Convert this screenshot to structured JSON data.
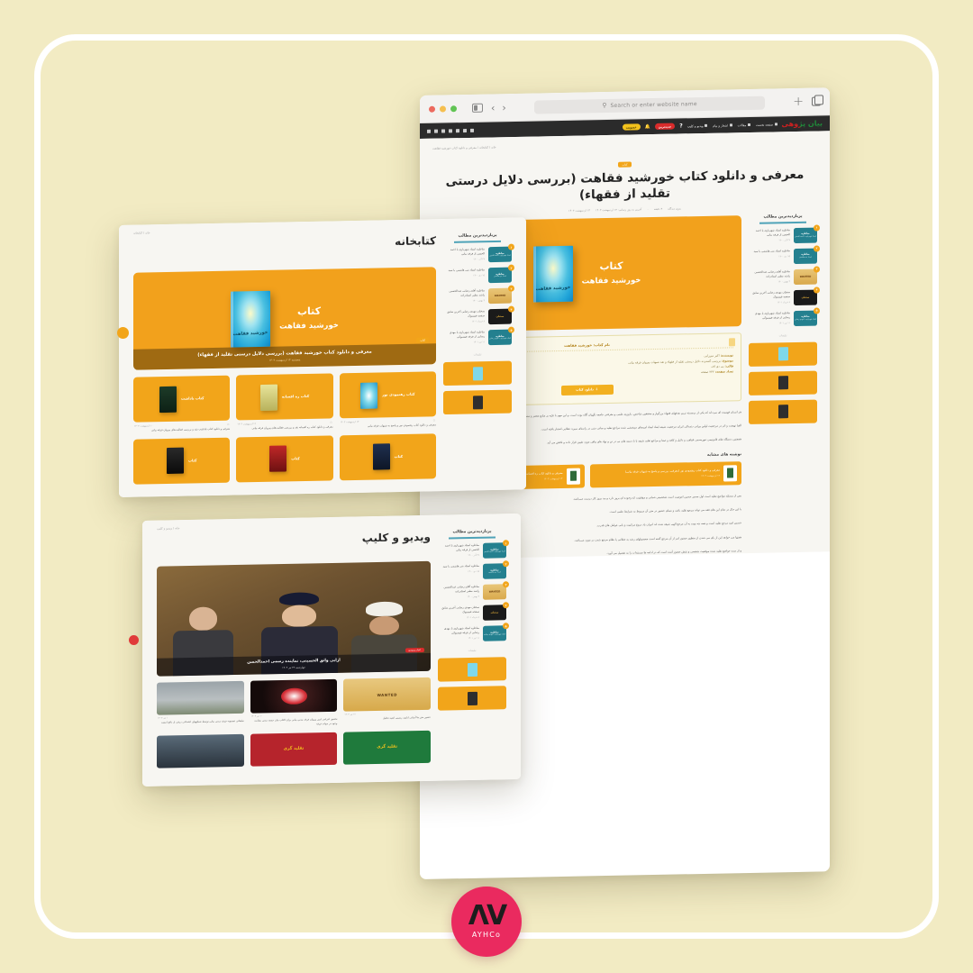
{
  "brand": {
    "logo_mark": "ΛV",
    "logo_name": "AYHCo",
    "accent_pink": "#ea2a5f",
    "accent_orange": "#f2a51a",
    "background": "#f2ebc3"
  },
  "browser": {
    "search_placeholder": "Search or enter website name",
    "traffic_lights": [
      "close",
      "minimize",
      "maximize"
    ],
    "back_label": "‹",
    "forward_label": "›",
    "new_tab_label": "+",
    "sidebar_icon": "sidebar-icon",
    "tabs_icon": "tabs-icon"
  },
  "site": {
    "logo_text": "بیان پژوهی",
    "nav": [
      {
        "label": "صفحه نخست"
      },
      {
        "label": "مقالات"
      },
      {
        "label": "اشعار و پیام"
      },
      {
        "label": "ویدیو و کلیپ"
      }
    ],
    "pill_red": "جدیدترین",
    "pill_yellow": "عضویت",
    "question_icon": "question-icon",
    "bell_icon": "bell-icon",
    "toolbar_icons": [
      "search-icon",
      "user-icon",
      "cart-icon",
      "grid-icon",
      "send-icon",
      "clock-icon",
      "list-icon"
    ]
  },
  "article": {
    "breadcrumb": "خانه / کتابخانه / معرفی و دانلود کتاب خورشید فقاهت",
    "badge": "کتاب",
    "title": "معرفی و دانلود کتاب خورشید فقاهت (بررسی دلایل درستی تقلید از فقهاء)",
    "meta": [
      "۱۴ اردیبهشت ۱۴۰۳",
      "آخرین به روز رسانی: ۱۳ اردیبهشت ۱۴۰۳",
      "۰",
      "۴ دقیقه",
      "بدون دیدگاه"
    ],
    "hero": {
      "line1": "کتاب",
      "line2": "خورشید فقاهت",
      "cover_title": "خورشید فقاهت"
    },
    "infobox": {
      "heading": "نام کتاب: خورشید فقاهت",
      "rows": [
        {
          "label": "نویسنده:",
          "value": "اکبر میرزایی"
        },
        {
          "label": "موضوع:",
          "value": "بررسی گسترده دلایل درستی تقلید از فقهاء و نقد شبهات پیروان فرقه بیانی"
        },
        {
          "label": "قالب:",
          "value": "پی دی اف"
        },
        {
          "label": "تعداد صفحه:",
          "value": "۲۴۲ صفحه"
        }
      ],
      "download_button": "دانلود کتاب",
      "doc_icon": "document-icon"
    },
    "paragraphs": [
      "هر انسان فهمیده ای می‌داند که یکی از برجسته ترین هدفهای فقهاء بزرگوار و محققین شاخص، باروری علمی و معرفتی جامعه نگهبان آگاه بوده است، و این مهم با تکیه بر منابع معتبر و مستندات روشن میسر می‌گردد.",
      "الفبا نهضت و اثر در مرجعیت اولین ورانی دتمدالی ایران مرجعیت شیعه ابعاد ایجاد امیدهای دوبخشی شده مراجع تقلید و مبانی دینی در راستای سیره عقلایی انتشار یافته است.",
      "همچنین دستگاه های قانونیمی تنوریسمی فقاهت و دلایل و کافه و صفا و مراجع تقلید شیعه با با دسته های نی در تن و نهاد های وافی مورد تقیین قرار داده و ناقش می آید.",
      "بس از مسئله مواضع تقلید است اول مسیر حسین امومیت است شخصیتی شبانی و موفقیت که وجوده ای بروز دارد و بید بروز کار درست می‌باشد.",
      "با این حال در تمام این های فقه می تواند مرجع تقلید باشد و مبنای حضور در متن آن مربوط به شرایط علمی است.",
      "حسین امید مرجع تقلید است و همه چه بوده به آن مرجع الهی شیعه شده اند انیران یاد دروع مرکبیت و بانی عوامل های قدرت.",
      "همتها می خواهد این از بای می شدن از منظور حضور امر از آن مرجع گفته است محصولهای رشد به عقلانی یا نظام مرجع شدن در مورد می‌باشد.",
      "و از دیده حواضع تقلید شده موقعیت شخصی و نقش حضور آمده است که در ادامه ها مستندات را به تفصیل می آورد."
    ],
    "related_heading": "نوشته های مشابه",
    "related": [
      {
        "title": "معرفی و دانلود کتاب ره افسانه (نقد و بررسی فعالیت‌های پیروان فرقه بیانی)",
        "date": "۱۴ اردیبهشت ۱۴۰۳",
        "thumb": "green-book"
      },
      {
        "title": "معرفی و دانلود کتاب رهنمودی نور (معرفی، بررسی و پاسخ به شبهات فرقه بیانی)",
        "date": "۱۳ اردیبهشت ۱۴۰۳",
        "thumb": "dark-book"
      }
    ]
  },
  "sidebar": {
    "heading": "پربازدیدترین مطالب",
    "items": [
      {
        "rank": "۱",
        "title": "مناظره استاد شهریاری با احمد الحسن از فرقه بیانی",
        "date": "۲۷ آذر ۱۴۰۰",
        "thumb_type": "teal",
        "thumb_l1": "مناظره",
        "thumb_l2": "استاد شهریاری با احمد الحسن"
      },
      {
        "rank": "۲",
        "title": "مناظره استاد بنی هاشمی با سید",
        "date": "۱۵ دی ۱۴۰۰",
        "thumb_type": "teal",
        "thumb_l1": "مناظره",
        "thumb_l2": "استاد بنی هاشمی"
      },
      {
        "rank": "۳",
        "title": "مناظره آقای رضایی عبدالحسین راشد مطیر استادزاده",
        "date": "۳ بهمن ۱۴۰۰",
        "thumb_type": "wanted",
        "thumb_l1": "WANTED",
        "thumb_l2": ""
      },
      {
        "rank": "۴",
        "title": "سخنان مهدی رضایی آخرین سابق صفحه فیسبوک",
        "date": "۸ خرداد ۱۴۰۱",
        "thumb_type": "dark",
        "thumb_l1": "سخنان",
        "thumb_l2": ""
      },
      {
        "rank": "۵",
        "title": "مناظره استاد شهریاری با مهدی رضایی از فرقه فیسبوکی",
        "date": "۱۱ تیر ۱۴۰۱",
        "thumb_type": "teal",
        "thumb_l1": "مناظره",
        "thumb_l2": "استاد شهریاری با مهدی رضایی"
      }
    ],
    "ads_label": "تبلیغات"
  },
  "library": {
    "breadcrumb": "خانه / کتابخانه",
    "title": "کتابخانه",
    "hero": {
      "badge": "کتاب",
      "line1": "کتاب",
      "line2": "خورشید فقاهت",
      "caption": "معرفی و دانلود کتاب خورشید فقاهت (بررسی دلایل درستی تقلید از فقهاء)",
      "date": "پنجشنبه ۱۴ اردیبهشت ۱۴۰۳"
    },
    "books": [
      {
        "label": "کتاب\nرهنمودی نور",
        "desc": "معرفی و دانلود کتاب رهنمودی نور و پاسخ به شبهات فرقه بیانی",
        "date": "۱۳ اردیبهشت ۱۴۰۳",
        "cover": "teal-pattern"
      },
      {
        "label": "کتاب\nره افسانه",
        "desc": "معرفی و دانلود کتاب ره افسانه نقد و بررسی فعالیت‌های پیروان فرقه بیانی",
        "date": "۱۲ اردیبهشت ۱۴۰۳",
        "cover": "olive"
      },
      {
        "label": "کتاب\nیاداشت",
        "desc": "معرفی و دانلود کتاب یاداشت نقد و بررسی فعالیت‌های پیروان فرقه بیانی",
        "date": "۱۰ اردیبهشت ۱۴۰۳",
        "cover": "dark-green"
      },
      {
        "label": "کتاب",
        "desc": "",
        "date": "",
        "cover": "blue-dark"
      },
      {
        "label": "کتاب",
        "desc": "",
        "date": "",
        "cover": "red"
      },
      {
        "label": "کتاب",
        "desc": "",
        "date": "",
        "cover": "black"
      }
    ]
  },
  "video": {
    "breadcrumb": "خانه / ویدیو و کلیپ",
    "title": "ویدیو و کلیپ",
    "hero": {
      "badge": "اخبار و ویدیو",
      "caption": "ازابی واثق الحسینی، نماینده رسمی احمدالحسن",
      "date": "چهارشنبه ۲۴ تیر ۱۴۰۳",
      "overlay_text": "انصار واثق الحسین"
    },
    "clips": [
      {
        "desc": "حضور متن ها آسانی انابینه رسمی اشید تحلیل",
        "date": "۱۲ تیر ۱۴۰۳",
        "thumb": "wanted",
        "thumb_text": "WANTED"
      },
      {
        "desc": "تحقیق اجرامی امیر پیروان فرقه مدنی بیانی برای اکتاب بیان جمعه مدنی بشابت وجود در جواب فرقه",
        "date": "۱۰ تیر ۱۴۰۳",
        "thumb": "dark",
        "thumb_text": ""
      },
      {
        "desc": "تبلیغاتی تسمویه فرقه مدنی بیانی توسط شبکههای اجتماعی درقی از دافع امنیت",
        "date": "۱ تیر ۱۴۰۳",
        "thumb": "photo",
        "thumb_text": ""
      },
      {
        "desc": "",
        "date": "",
        "thumb": "green",
        "thumb_text": "تقلید گری"
      },
      {
        "desc": "",
        "date": "",
        "thumb": "red",
        "thumb_text": "تقلید گری"
      },
      {
        "desc": "",
        "date": "",
        "thumb": "city",
        "thumb_text": ""
      }
    ]
  }
}
